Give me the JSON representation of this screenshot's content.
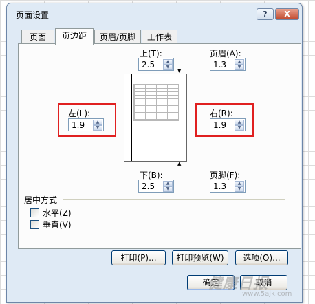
{
  "dialog": {
    "title": "页面设置",
    "help_label": "?",
    "close_label": "X"
  },
  "tabs": [
    {
      "label": "页面",
      "active": false
    },
    {
      "label": "页边距",
      "active": true
    },
    {
      "label": "页眉/页脚",
      "active": false
    },
    {
      "label": "工作表",
      "active": false
    }
  ],
  "margins": {
    "top": {
      "label": "上(T):",
      "value": "2.5"
    },
    "header": {
      "label": "页眉(A):",
      "value": "1.3"
    },
    "left": {
      "label": "左(L):",
      "value": "1.9"
    },
    "right": {
      "label": "右(R):",
      "value": "1.9"
    },
    "bottom": {
      "label": "下(B):",
      "value": "2.5"
    },
    "footer": {
      "label": "页脚(F):",
      "value": "1.3"
    }
  },
  "centering": {
    "title": "居中方式",
    "horizontal": {
      "label": "水平(Z)",
      "checked": false
    },
    "vertical": {
      "label": "垂直(V)",
      "checked": false
    }
  },
  "buttons": {
    "print": "打印(P)...",
    "preview": "打印预览(W)",
    "options": "选项(O)...",
    "ok": "确定",
    "cancel": "取消"
  },
  "icons": {
    "spin_up": "▲",
    "spin_down": "▼",
    "marker_down": "▼",
    "marker_up": "▲"
  },
  "watermark": {
    "main": "健康日报",
    "sub": "www.5ajk.com"
  },
  "colors": {
    "highlight": "#e02020",
    "dialog_bg": "#dfeaf5",
    "close_button": "#c14a2e"
  }
}
